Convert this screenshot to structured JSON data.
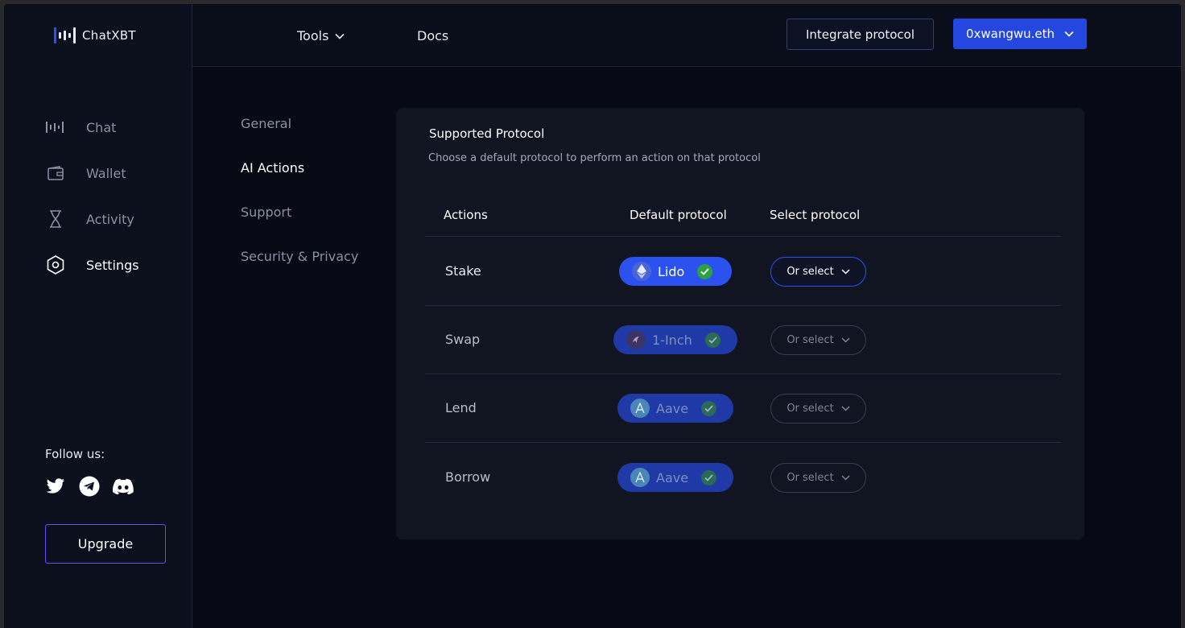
{
  "brand": {
    "name": "ChatXBT",
    "accent": "#2447e0"
  },
  "sidebar": {
    "items": [
      {
        "label": "Chat",
        "icon": "soundwave-icon"
      },
      {
        "label": "Wallet",
        "icon": "wallet-icon"
      },
      {
        "label": "Activity",
        "icon": "hourglass-icon"
      },
      {
        "label": "Settings",
        "icon": "hexagon-settings-icon",
        "active": true
      }
    ],
    "follow_label": "Follow us:",
    "socials": [
      "twitter-icon",
      "telegram-icon",
      "discord-icon"
    ],
    "upgrade_label": "Upgrade"
  },
  "topbar": {
    "tools_label": "Tools",
    "docs_label": "Docs",
    "integrate_label": "Integrate protocol",
    "wallet_label": "0xwangwu.eth"
  },
  "settings_menu": [
    {
      "label": "General"
    },
    {
      "label": "AI Actions",
      "active": true
    },
    {
      "label": "Support"
    },
    {
      "label": "Security & Privacy"
    }
  ],
  "card": {
    "title": "Supported Protocol",
    "subtitle": "Choose a default protocol to perform an action on that protocol",
    "columns": [
      "Actions",
      "Default protocol",
      "Select protocol"
    ],
    "rows": [
      {
        "action": "Stake",
        "protocol": "Lido",
        "select_label": "Or select"
      },
      {
        "action": "Swap",
        "protocol": "1-Inch",
        "select_label": "Or select"
      },
      {
        "action": "Lend",
        "protocol": "Aave",
        "select_label": "Or select"
      },
      {
        "action": "Borrow",
        "protocol": "Aave",
        "select_label": "Or select"
      }
    ]
  }
}
